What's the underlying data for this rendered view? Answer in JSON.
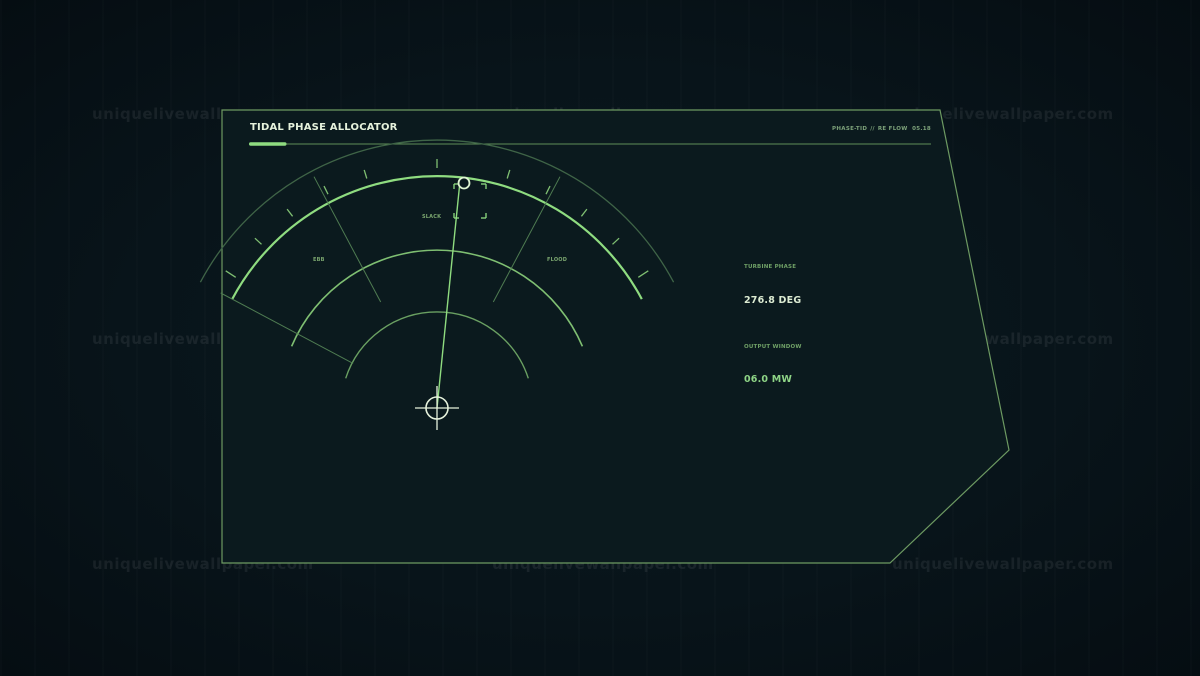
{
  "watermark": "uniquelivewallpaper.com",
  "header": {
    "title": "TIDAL PHASE ALLOCATOR",
    "code": "PHASE-TID",
    "separator": "//",
    "mode": "RE FLOW",
    "version": "05.18"
  },
  "progress": {
    "fraction": 0.055
  },
  "dial": {
    "labels": {
      "ebb": "EBB",
      "slack": "SLACK",
      "flood": "FLOOD"
    }
  },
  "readouts": {
    "turbine_phase": {
      "label": "TURBINE PHASE",
      "value": "276.8 DEG"
    },
    "output_window": {
      "label": "OUTPUT WINDOW",
      "value": "06.0 MW"
    }
  },
  "colors": {
    "panel_bg": "#0b1a1e",
    "panel_border": "#6d9a62",
    "accent": "#8fdc80",
    "accent_dim": "#5f8e58",
    "text_bright": "#e6f2dc"
  }
}
